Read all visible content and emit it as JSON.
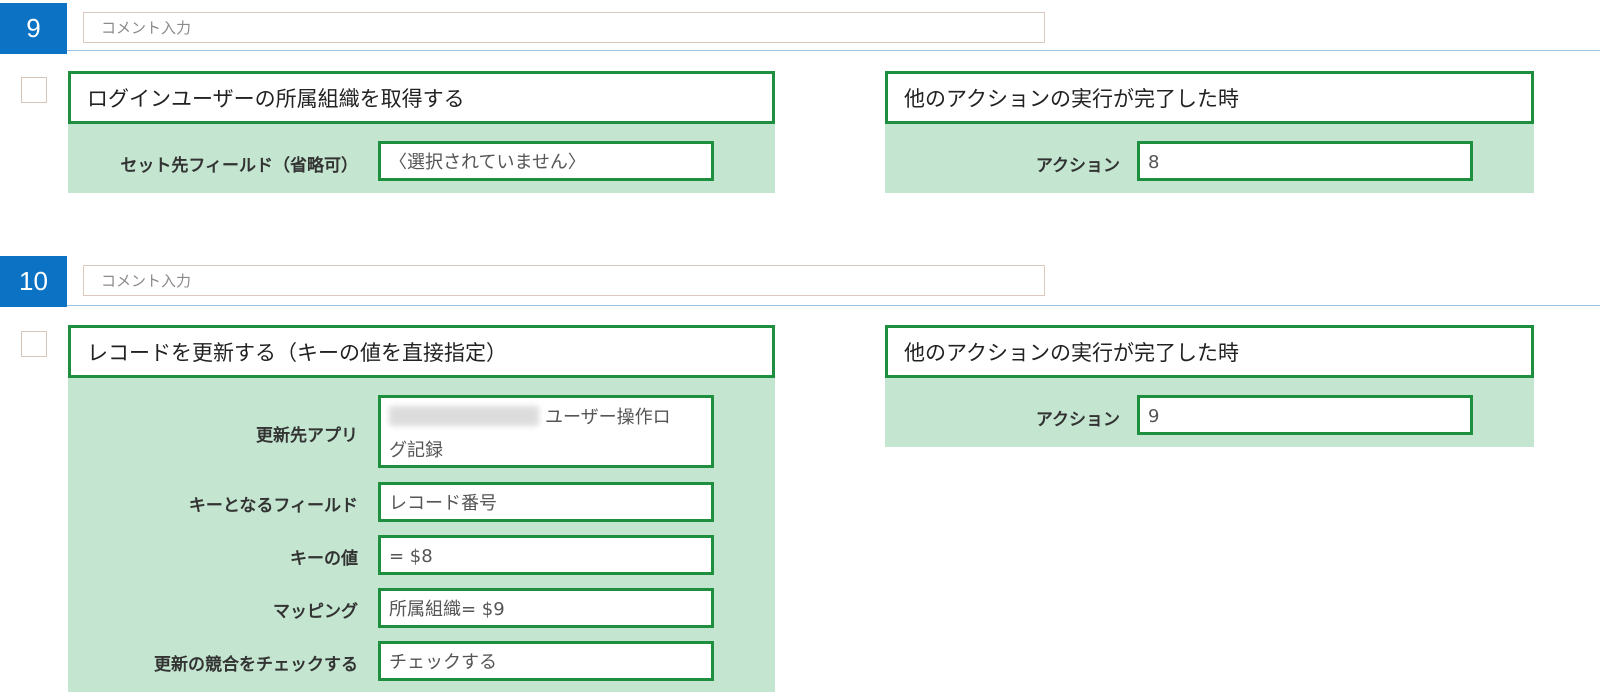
{
  "steps": [
    {
      "number": "9",
      "comment_placeholder": "コメント入力",
      "action": {
        "title": "ログインユーザーの所属組織を取得する",
        "fields": [
          {
            "label": "セット先フィールド（省略可）",
            "value": "〈選択されていません〉"
          }
        ]
      },
      "trigger": {
        "title": "他のアクションの実行が完了した時",
        "label": "アクション",
        "value": "8"
      }
    },
    {
      "number": "10",
      "comment_placeholder": "コメント入力",
      "action": {
        "title": "レコードを更新する（キーの値を直接指定）",
        "fields": [
          {
            "label": "更新先アプリ",
            "value_line1": "ユーザー操作ロ",
            "value_line2": "グ記録"
          },
          {
            "label": "キーとなるフィールド",
            "value": "レコード番号"
          },
          {
            "label": "キーの値",
            "value": "= $8"
          },
          {
            "label": "マッピング",
            "value": "所属組織= $9"
          },
          {
            "label": "更新の競合をチェックする",
            "value": "チェックする"
          }
        ]
      },
      "trigger": {
        "title": "他のアクションの実行が完了した時",
        "label": "アクション",
        "value": "9"
      }
    }
  ],
  "colors": {
    "step_badge": "#0b72c4",
    "panel_border": "#1e8f3e",
    "panel_fill": "#c4e6d0"
  }
}
